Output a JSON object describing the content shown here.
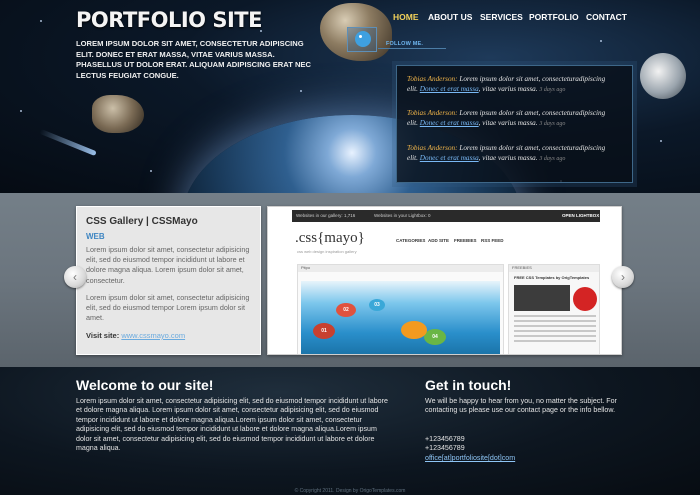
{
  "header": {
    "logo": "PORTFOLIO SITE",
    "intro": "LOREM IPSUM DOLOR SIT AMET, CONSECTETUR ADIPISCING ELIT. DONEC ET ERAT MASSA, VITAE VARIUS MASSA. PHASELLUS UT DOLOR ERAT. ALIQUAM ADIPISCING ERAT NEC LECTUS FEUGIAT CONGUE.",
    "nav": [
      {
        "label": "HOME",
        "active": true
      },
      {
        "label": "ABOUT US"
      },
      {
        "label": "SERVICES"
      },
      {
        "label": "PORTFOLIO"
      },
      {
        "label": "CONTACT"
      }
    ],
    "follow_label": "FOLLOW ME."
  },
  "tweets": [
    {
      "author": "Tobias Anderson:",
      "text": " Lorem ipsum dolor sit amet, consecteturadipiscing elit. ",
      "link": "Donec et erat massa",
      "after": ", vitae varius massa. ",
      "time": "3 days ago"
    },
    {
      "author": "Tobias Anderson:",
      "text": " Lorem ipsum dolor sit amet, consecteturadipiscing elit. ",
      "link": "Donec et erat massa",
      "after": ", vitae varius massa. ",
      "time": "3 days ago"
    },
    {
      "author": "Tobias Anderson:",
      "text": " Lorem ipsum dolor sit amet, consecteturadipiscing elit. ",
      "link": "Donec et erat massa",
      "after": ", vitae varius massa. ",
      "time": "3 days ago"
    }
  ],
  "slide": {
    "title": "CSS Gallery | CSSMayo",
    "tag": "WEB",
    "para1": "Lorem ipsum dolor sit amet, consectetur adipisicing elit, sed do eiusmod tempor incididunt ut labore et dolore magna aliqua. Lorem ipsum dolor sit amet, consectetur.",
    "para2": "Lorem ipsum dolor sit amet, consectetur adipisicing elit, sed do eiusmod tempor Lorem ipsum dolor sit amet.",
    "visit_label": "Visit site:",
    "visit_url": "www.cssmayo.com",
    "prev_icon": "‹",
    "next_icon": "›"
  },
  "preview": {
    "bar_left": "Websites in our gallery: 1,716",
    "bar_mid": "Websites in your Lightbox: 0",
    "bar_right": "OPEN LIGHTBOX",
    "logo": ".css{mayo}",
    "sub": "css web design inspiration gallery",
    "menu": [
      "CATEGORIES",
      "ADD SITE",
      "FREEBIES",
      "RSS FEED"
    ],
    "main_head": "Pitpo",
    "side_head": "FREEBIES",
    "side_title": "FREE CSS Templates by OrigTemplates",
    "bubbles": [
      "02",
      "03",
      "01",
      "04"
    ]
  },
  "welcome": {
    "title": "Welcome to our site!",
    "text": "Lorem ipsum dolor sit amet, consectetur adipisicing elit, sed do eiusmod tempor incididunt ut labore et dolore magna aliqua. Lorem ipsum dolor sit amet, consectetur adipisicing elit, sed do eiusmod tempor incididunt ut labore et dolore magna aliqua.Lorem ipsum dolor sit amet, consectetur adipisicing elit, sed do eiusmod tempor incididunt ut labore et dolore magna aliqua.Lorem ipsum dolor sit amet, consectetur adipisicing elit, sed do eiusmod tempor incididunt ut labore et dolore magna aliqua."
  },
  "contact": {
    "title": "Get in touch!",
    "text": "We will be happy to hear from you, no matter the subject. For contacting us please use our contact page or the info bellow.",
    "phone1": "+123456789",
    "phone2": "+123456789",
    "email": "office[at]portfoliosite[dot]com"
  },
  "footer": {
    "copyright": "© Copyright 2011. Design by OrigoTemplates.com"
  }
}
